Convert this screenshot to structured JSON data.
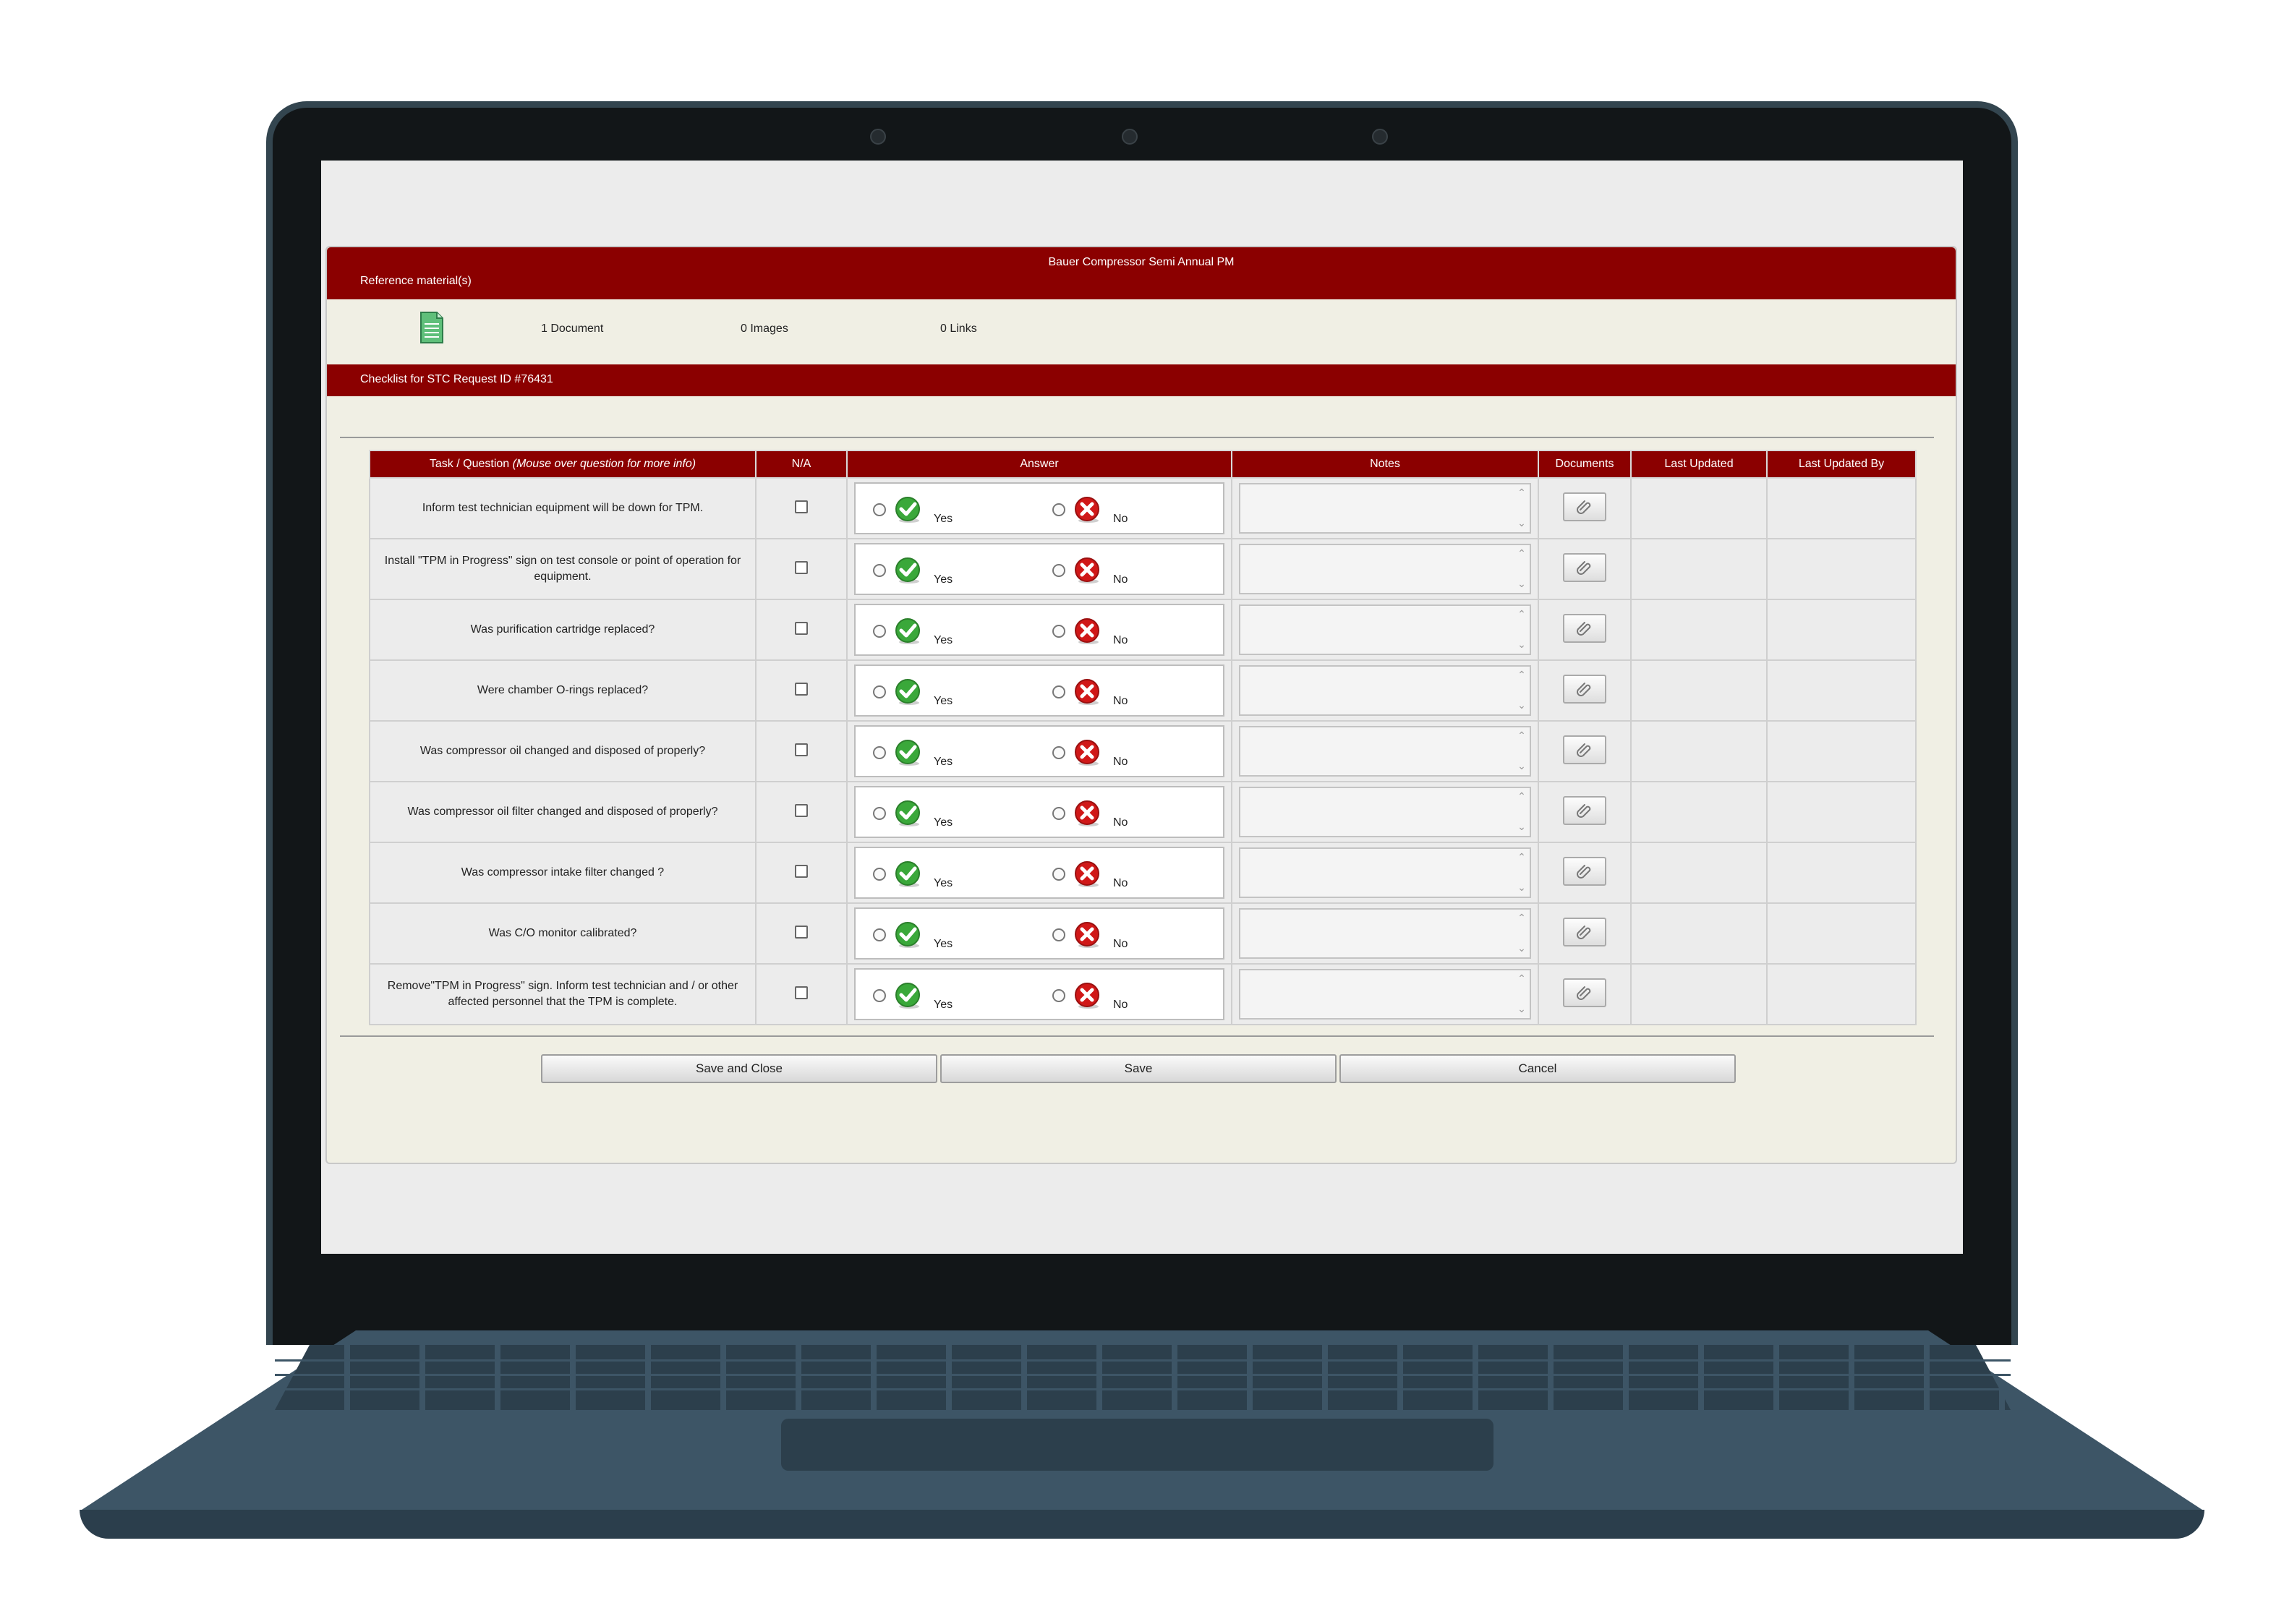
{
  "form": {
    "title": "Bauer Compressor Semi Annual PM",
    "reference_label": "Reference material(s)",
    "documents_count": "1 Document",
    "images_count": "0 Images",
    "links_count": "0 Links",
    "checklist_label": "Checklist for STC Request ID #76431"
  },
  "table": {
    "headers": {
      "task": "Task / Question",
      "task_hint": "(Mouse over question for more info)",
      "na": "N/A",
      "answer": "Answer",
      "notes": "Notes",
      "documents": "Documents",
      "last_updated": "Last Updated",
      "last_updated_by": "Last Updated By"
    },
    "yes_label": "Yes",
    "no_label": "No",
    "rows": [
      {
        "task": "Inform test technician equipment will be down for TPM."
      },
      {
        "task": "Install \"TPM in Progress\" sign on test console or point of operation for equipment."
      },
      {
        "task": "Was purification cartridge replaced?"
      },
      {
        "task": "Were chamber O-rings replaced?"
      },
      {
        "task": "Was compressor oil changed and disposed of properly?"
      },
      {
        "task": "Was compressor oil filter changed and disposed of properly?"
      },
      {
        "task": "Was compressor intake filter changed ?"
      },
      {
        "task": "Was C/O monitor calibrated?"
      },
      {
        "task": "Remove\"TPM in Progress\" sign. Inform test technician and / or other affected personnel that the TPM is complete."
      }
    ]
  },
  "buttons": {
    "save_close": "Save and Close",
    "save": "Save",
    "cancel": "Cancel"
  },
  "colors": {
    "accent": "#8b0000",
    "panel_bg": "#f0efe4",
    "yes_icon": "#3aa83a",
    "no_icon": "#d01818"
  }
}
